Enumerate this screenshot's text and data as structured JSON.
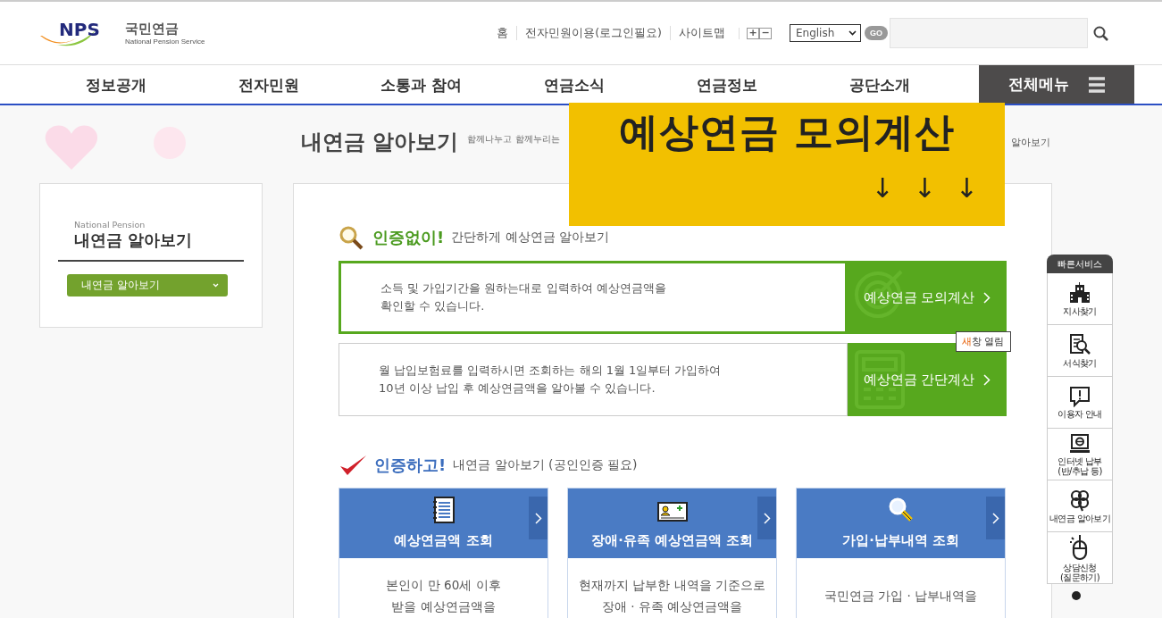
{
  "logo": {
    "mark": "NPS",
    "name": "국민연금",
    "subtitle": "National Pension Service"
  },
  "util_links": [
    {
      "label": "홈"
    },
    {
      "label": "전자민원이용(로그인필요)"
    },
    {
      "label": "사이트맵"
    }
  ],
  "font_size_buttons": [
    "+",
    "−"
  ],
  "language_select": {
    "value": "English"
  },
  "go_button": "GO",
  "nav": [
    {
      "label": "정보공개",
      "selected": false
    },
    {
      "label": "전자민원",
      "selected": false
    },
    {
      "label": "소통과 참여",
      "selected": false
    },
    {
      "label": "연금소식",
      "selected": false
    },
    {
      "label": "연금정보",
      "selected": false
    },
    {
      "label": "공단소개",
      "selected": false
    }
  ],
  "all_menu": "전체메뉴",
  "page_title": "내연금 알아보기",
  "page_subtitle": "함께나누고 함께누리는",
  "breadcrumb_tail": "알아보기",
  "sidebar": {
    "eyebrow": "National Pension",
    "title": "내연금 알아보기",
    "dropdown": "내연금 알아보기"
  },
  "section1": {
    "lead": "인증없이!",
    "title": "간단하게 예상연금 알아보기"
  },
  "simple_cards": [
    {
      "description": "소득 및 가입기간을 원하는대로 입력하여 예상연금액을\n확인할 수 있습니다.",
      "action": "예상연금 모의계산",
      "highlighted": true,
      "kind": "target"
    },
    {
      "description": "월 납입보험료를 입력하시면 조회하는 해의 1월 1일부터 가입하여\n10년 이상 납입 후 예상연금액을 알아볼 수 있습니다.",
      "action": "예상연금 간단계산",
      "highlighted": false,
      "kind": "calculator"
    }
  ],
  "tooltip": {
    "highlight": "새",
    "rest": "창 열림"
  },
  "section2": {
    "lead": "인증하고!",
    "title": "내연금 알아보기 (공인인증 필요)"
  },
  "auth_cards": [
    {
      "title": "예상연금액 조회",
      "kind": "document",
      "lines": [
        "본인이 만 60세 이후",
        "받을 예상연금액을"
      ]
    },
    {
      "title": "장애·유족 예상연금액 조회",
      "kind": "id-card",
      "lines": [
        "현재까지 납부한 내역을 기준으로",
        "장애  · 유족 예상연금액을"
      ]
    },
    {
      "title": "가입·납부내역 조회",
      "kind": "magnifier",
      "lines": [
        "국민연금 가입  · 납부내역을"
      ]
    }
  ],
  "quick_service": {
    "title": "빠른서비스",
    "items": [
      {
        "label": "지사찾기",
        "kind": "building"
      },
      {
        "label": "서식찾기",
        "kind": "form-search"
      },
      {
        "label": "이용자 안내",
        "kind": "notice"
      },
      {
        "label": "인터넷 납부\n(반/추납 등)",
        "kind": "monitor"
      },
      {
        "label": "내연금 알아보기",
        "kind": "clover"
      },
      {
        "label": "상담신청\n(질문하기)",
        "kind": "mouse"
      }
    ]
  },
  "overlay": {
    "title": "예상연금 모의계산",
    "arrows": [
      "↓",
      "↓",
      "↓"
    ]
  }
}
